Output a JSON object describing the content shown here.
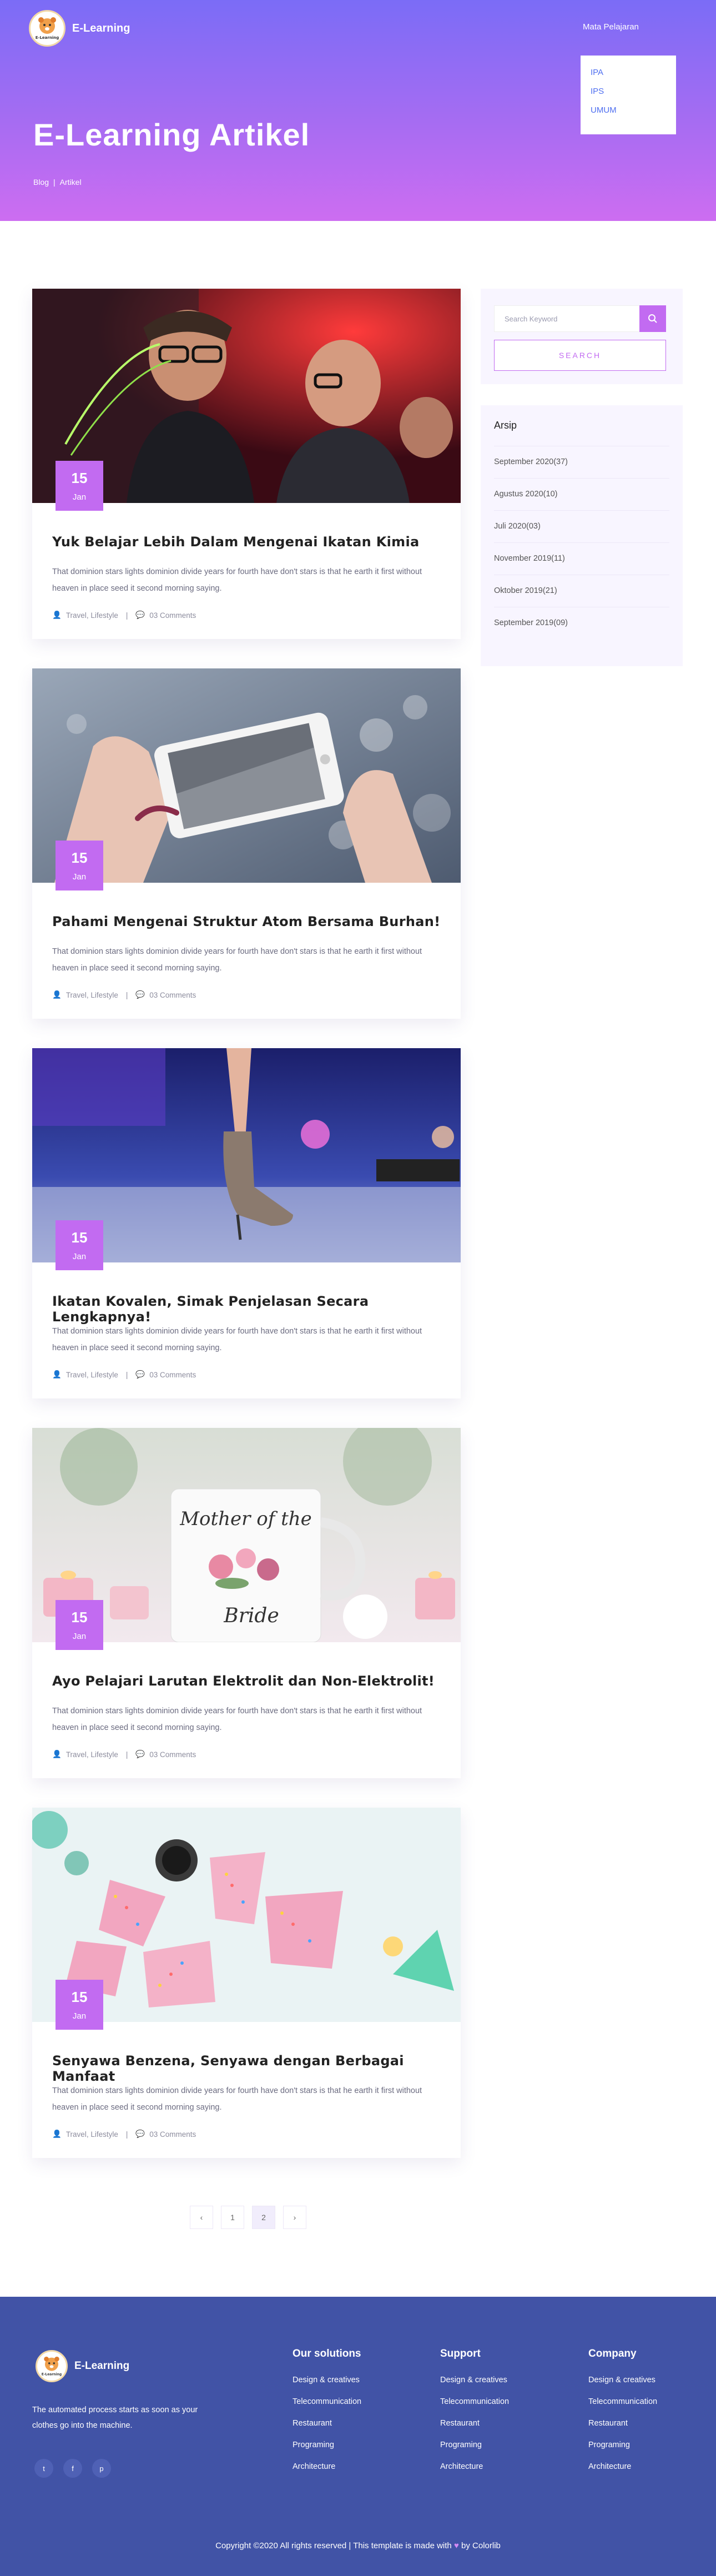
{
  "brand": {
    "name": "E-Learning",
    "logo_text": "E-Learning"
  },
  "nav": {
    "menu_label": "Mata Pelajaran",
    "dropdown": [
      "IPA",
      "IPS",
      "UMUM"
    ]
  },
  "hero": {
    "title": "E-Learning Artikel",
    "breadcrumb": [
      "Blog",
      "|",
      "Artikel"
    ]
  },
  "posts": [
    {
      "day": "15",
      "month": "Jan",
      "title": "Yuk Belajar Lebih Dalam Mengenai Ikatan Kimia",
      "excerpt": "That dominion stars lights dominion divide years for fourth have don't stars is that he earth it first without heaven in place seed it second morning saying.",
      "meta_tags": "Travel, Lifestyle",
      "meta_comments": "03 Comments",
      "image": "party-people"
    },
    {
      "day": "15",
      "month": "Jan",
      "title": "Pahami Mengenai Struktur Atom Bersama Burhan!",
      "excerpt": "That dominion stars lights dominion divide years for fourth have don't stars is that he earth it first without heaven in place seed it second morning saying.",
      "meta_tags": "Travel, Lifestyle",
      "meta_comments": "03 Comments",
      "image": "phone-photo"
    },
    {
      "day": "15",
      "month": "Jan",
      "title": "Ikatan Kovalen, Simak Penjelasan Secara Lengkapnya!",
      "excerpt": "That dominion stars lights dominion divide years for fourth have don't stars is that he earth it first without heaven in place seed it second morning saying.",
      "meta_tags": "Travel, Lifestyle",
      "meta_comments": "03 Comments",
      "image": "stage-shoes"
    },
    {
      "day": "15",
      "month": "Jan",
      "title": "Ayo Pelajari Larutan Elektrolit dan Non-Elektrolit!",
      "excerpt": "That dominion stars lights dominion divide years for fourth have don't stars is that he earth it first without heaven in place seed it second morning saying.",
      "meta_tags": "Travel, Lifestyle",
      "meta_comments": "03 Comments",
      "image": "mug-candles",
      "image_text": [
        "Mother of the",
        "Bride"
      ]
    },
    {
      "day": "15",
      "month": "Jan",
      "title": "Senyawa Benzena, Senyawa dengan Berbagai Manfaat",
      "excerpt": "That dominion stars lights dominion divide years for fourth have don't stars is that he earth it first without heaven in place seed it second morning saying.",
      "meta_tags": "Travel, Lifestyle",
      "meta_comments": "03 Comments",
      "image": "sprinkle-treats"
    }
  ],
  "sidebar": {
    "search_placeholder": "Search Keyword",
    "search_button": "SEARCH",
    "archive_title": "Arsip",
    "archive": [
      "September 2020(37)",
      "Agustus 2020(10)",
      "Juli 2020(03)",
      "November 2019(11)",
      "Oktober 2019(21)",
      "September 2019(09)"
    ]
  },
  "pagination": {
    "prev": "‹",
    "pages": [
      "1",
      "2"
    ],
    "next": "›",
    "active": "2"
  },
  "footer": {
    "brand": "E-Learning",
    "description": "The automated process starts as soon as your clothes go into the machine.",
    "social": [
      "t",
      "f",
      "p"
    ],
    "columns": [
      {
        "title": "Our solutions",
        "items": [
          "Design & creatives",
          "Telecommunication",
          "Restaurant",
          "Programing",
          "Architecture"
        ]
      },
      {
        "title": "Support",
        "items": [
          "Design & creatives",
          "Telecommunication",
          "Restaurant",
          "Programing",
          "Architecture"
        ]
      },
      {
        "title": "Company",
        "items": [
          "Design & creatives",
          "Telecommunication",
          "Restaurant",
          "Programing",
          "Architecture"
        ]
      }
    ],
    "copyright_before": "Copyright ©2020 All rights reserved | This template is made with",
    "copyright_after": "by Colorlib"
  },
  "colors": {
    "accent": "#c26bf1",
    "footer_bg": "#4153a6",
    "hero_start": "#7b6cf6",
    "hero_end": "#cd6df1"
  }
}
